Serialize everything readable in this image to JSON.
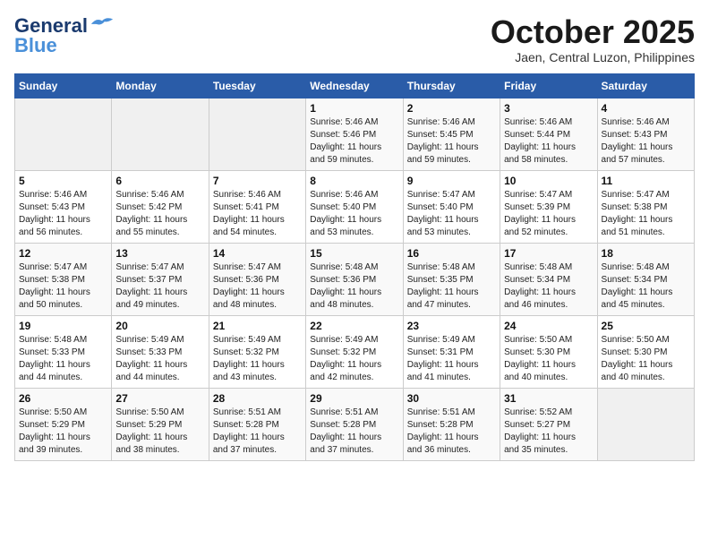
{
  "header": {
    "logo_line1": "General",
    "logo_line2": "Blue",
    "month": "October 2025",
    "location": "Jaen, Central Luzon, Philippines"
  },
  "weekdays": [
    "Sunday",
    "Monday",
    "Tuesday",
    "Wednesday",
    "Thursday",
    "Friday",
    "Saturday"
  ],
  "weeks": [
    [
      {
        "day": "",
        "info": ""
      },
      {
        "day": "",
        "info": ""
      },
      {
        "day": "",
        "info": ""
      },
      {
        "day": "1",
        "info": "Sunrise: 5:46 AM\nSunset: 5:46 PM\nDaylight: 11 hours\nand 59 minutes."
      },
      {
        "day": "2",
        "info": "Sunrise: 5:46 AM\nSunset: 5:45 PM\nDaylight: 11 hours\nand 59 minutes."
      },
      {
        "day": "3",
        "info": "Sunrise: 5:46 AM\nSunset: 5:44 PM\nDaylight: 11 hours\nand 58 minutes."
      },
      {
        "day": "4",
        "info": "Sunrise: 5:46 AM\nSunset: 5:43 PM\nDaylight: 11 hours\nand 57 minutes."
      }
    ],
    [
      {
        "day": "5",
        "info": "Sunrise: 5:46 AM\nSunset: 5:43 PM\nDaylight: 11 hours\nand 56 minutes."
      },
      {
        "day": "6",
        "info": "Sunrise: 5:46 AM\nSunset: 5:42 PM\nDaylight: 11 hours\nand 55 minutes."
      },
      {
        "day": "7",
        "info": "Sunrise: 5:46 AM\nSunset: 5:41 PM\nDaylight: 11 hours\nand 54 minutes."
      },
      {
        "day": "8",
        "info": "Sunrise: 5:46 AM\nSunset: 5:40 PM\nDaylight: 11 hours\nand 53 minutes."
      },
      {
        "day": "9",
        "info": "Sunrise: 5:47 AM\nSunset: 5:40 PM\nDaylight: 11 hours\nand 53 minutes."
      },
      {
        "day": "10",
        "info": "Sunrise: 5:47 AM\nSunset: 5:39 PM\nDaylight: 11 hours\nand 52 minutes."
      },
      {
        "day": "11",
        "info": "Sunrise: 5:47 AM\nSunset: 5:38 PM\nDaylight: 11 hours\nand 51 minutes."
      }
    ],
    [
      {
        "day": "12",
        "info": "Sunrise: 5:47 AM\nSunset: 5:38 PM\nDaylight: 11 hours\nand 50 minutes."
      },
      {
        "day": "13",
        "info": "Sunrise: 5:47 AM\nSunset: 5:37 PM\nDaylight: 11 hours\nand 49 minutes."
      },
      {
        "day": "14",
        "info": "Sunrise: 5:47 AM\nSunset: 5:36 PM\nDaylight: 11 hours\nand 48 minutes."
      },
      {
        "day": "15",
        "info": "Sunrise: 5:48 AM\nSunset: 5:36 PM\nDaylight: 11 hours\nand 48 minutes."
      },
      {
        "day": "16",
        "info": "Sunrise: 5:48 AM\nSunset: 5:35 PM\nDaylight: 11 hours\nand 47 minutes."
      },
      {
        "day": "17",
        "info": "Sunrise: 5:48 AM\nSunset: 5:34 PM\nDaylight: 11 hours\nand 46 minutes."
      },
      {
        "day": "18",
        "info": "Sunrise: 5:48 AM\nSunset: 5:34 PM\nDaylight: 11 hours\nand 45 minutes."
      }
    ],
    [
      {
        "day": "19",
        "info": "Sunrise: 5:48 AM\nSunset: 5:33 PM\nDaylight: 11 hours\nand 44 minutes."
      },
      {
        "day": "20",
        "info": "Sunrise: 5:49 AM\nSunset: 5:33 PM\nDaylight: 11 hours\nand 44 minutes."
      },
      {
        "day": "21",
        "info": "Sunrise: 5:49 AM\nSunset: 5:32 PM\nDaylight: 11 hours\nand 43 minutes."
      },
      {
        "day": "22",
        "info": "Sunrise: 5:49 AM\nSunset: 5:32 PM\nDaylight: 11 hours\nand 42 minutes."
      },
      {
        "day": "23",
        "info": "Sunrise: 5:49 AM\nSunset: 5:31 PM\nDaylight: 11 hours\nand 41 minutes."
      },
      {
        "day": "24",
        "info": "Sunrise: 5:50 AM\nSunset: 5:30 PM\nDaylight: 11 hours\nand 40 minutes."
      },
      {
        "day": "25",
        "info": "Sunrise: 5:50 AM\nSunset: 5:30 PM\nDaylight: 11 hours\nand 40 minutes."
      }
    ],
    [
      {
        "day": "26",
        "info": "Sunrise: 5:50 AM\nSunset: 5:29 PM\nDaylight: 11 hours\nand 39 minutes."
      },
      {
        "day": "27",
        "info": "Sunrise: 5:50 AM\nSunset: 5:29 PM\nDaylight: 11 hours\nand 38 minutes."
      },
      {
        "day": "28",
        "info": "Sunrise: 5:51 AM\nSunset: 5:28 PM\nDaylight: 11 hours\nand 37 minutes."
      },
      {
        "day": "29",
        "info": "Sunrise: 5:51 AM\nSunset: 5:28 PM\nDaylight: 11 hours\nand 37 minutes."
      },
      {
        "day": "30",
        "info": "Sunrise: 5:51 AM\nSunset: 5:28 PM\nDaylight: 11 hours\nand 36 minutes."
      },
      {
        "day": "31",
        "info": "Sunrise: 5:52 AM\nSunset: 5:27 PM\nDaylight: 11 hours\nand 35 minutes."
      },
      {
        "day": "",
        "info": ""
      }
    ]
  ]
}
